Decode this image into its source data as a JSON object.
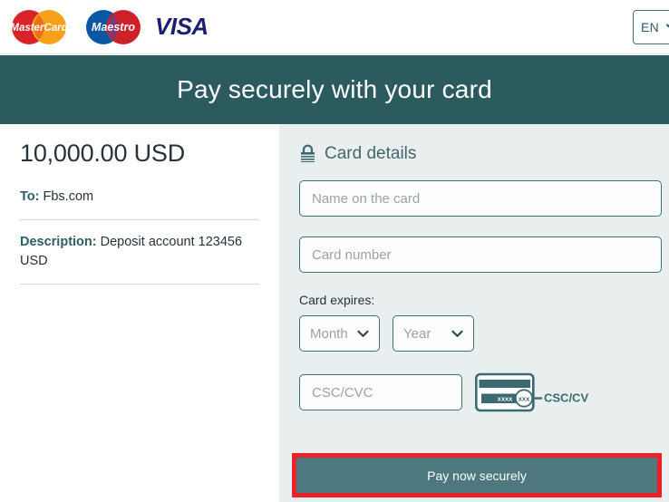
{
  "topbar": {
    "logos": [
      {
        "name": "mastercard-logo",
        "text": "MasterCard"
      },
      {
        "name": "maestro-logo",
        "text": "Maestro"
      },
      {
        "name": "visa-logo",
        "text": "VISA"
      }
    ],
    "language": {
      "value": "EN",
      "chevron_icon": "chevron-down-icon"
    }
  },
  "banner": {
    "title": "Pay securely with your card",
    "background": "#2b5b5f"
  },
  "summary": {
    "amount": "10,000.00 USD",
    "to_label": "To:",
    "to_value": "Fbs.com",
    "description_label": "Description:",
    "description_value": "Deposit account 123456 USD"
  },
  "form": {
    "lock_icon": "lock-icon",
    "heading": "Card details",
    "name_on_card_placeholder": "Name on the card",
    "card_number_placeholder": "Card number",
    "expires_label": "Card expires:",
    "month_placeholder": "Month",
    "year_placeholder": "Year",
    "cvc_placeholder": "CSC/CVC",
    "cvc_hint_label": "CSC/CVC",
    "cvc_card_strip_text": "xxxx",
    "cvc_card_circle_text": "xxx",
    "pay_button_label": "Pay now securely",
    "panel_background": "#e9eeee",
    "accent": "#3f7179",
    "button_color": "#4d787f",
    "highlight_color": "#ec2027"
  }
}
